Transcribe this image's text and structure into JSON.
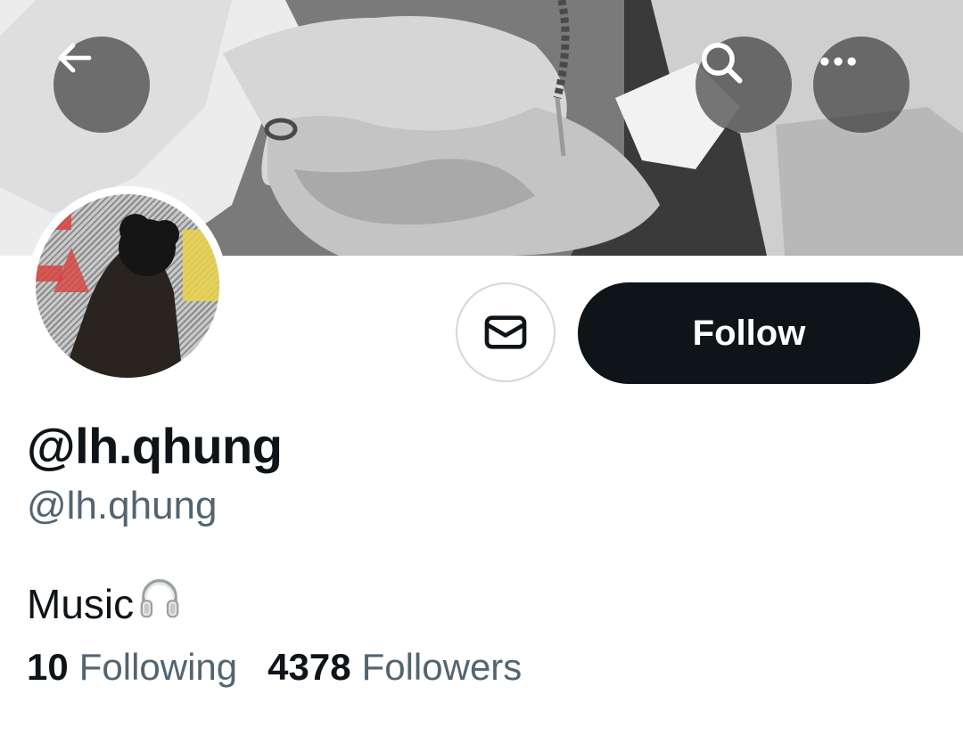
{
  "colors": {
    "primary_text": "#0f1419",
    "secondary_text": "#536471",
    "follow_bg": "#0f1419",
    "follow_text": "#ffffff",
    "border": "#cfd9de",
    "overlay_button": "#282828"
  },
  "header": {
    "icons": [
      "arrow-left-icon",
      "search-icon",
      "more-horizontal-icon"
    ]
  },
  "actions": {
    "message_icon": "envelope-icon",
    "follow_label": "Follow"
  },
  "profile": {
    "display_name": "@lh.qhung",
    "handle": "@lh.qhung",
    "bio_text": "Music",
    "bio_icon": "headphones-icon"
  },
  "stats": {
    "following_count": "10",
    "following_label": "Following",
    "followers_count": "4378",
    "followers_label": "Followers"
  }
}
